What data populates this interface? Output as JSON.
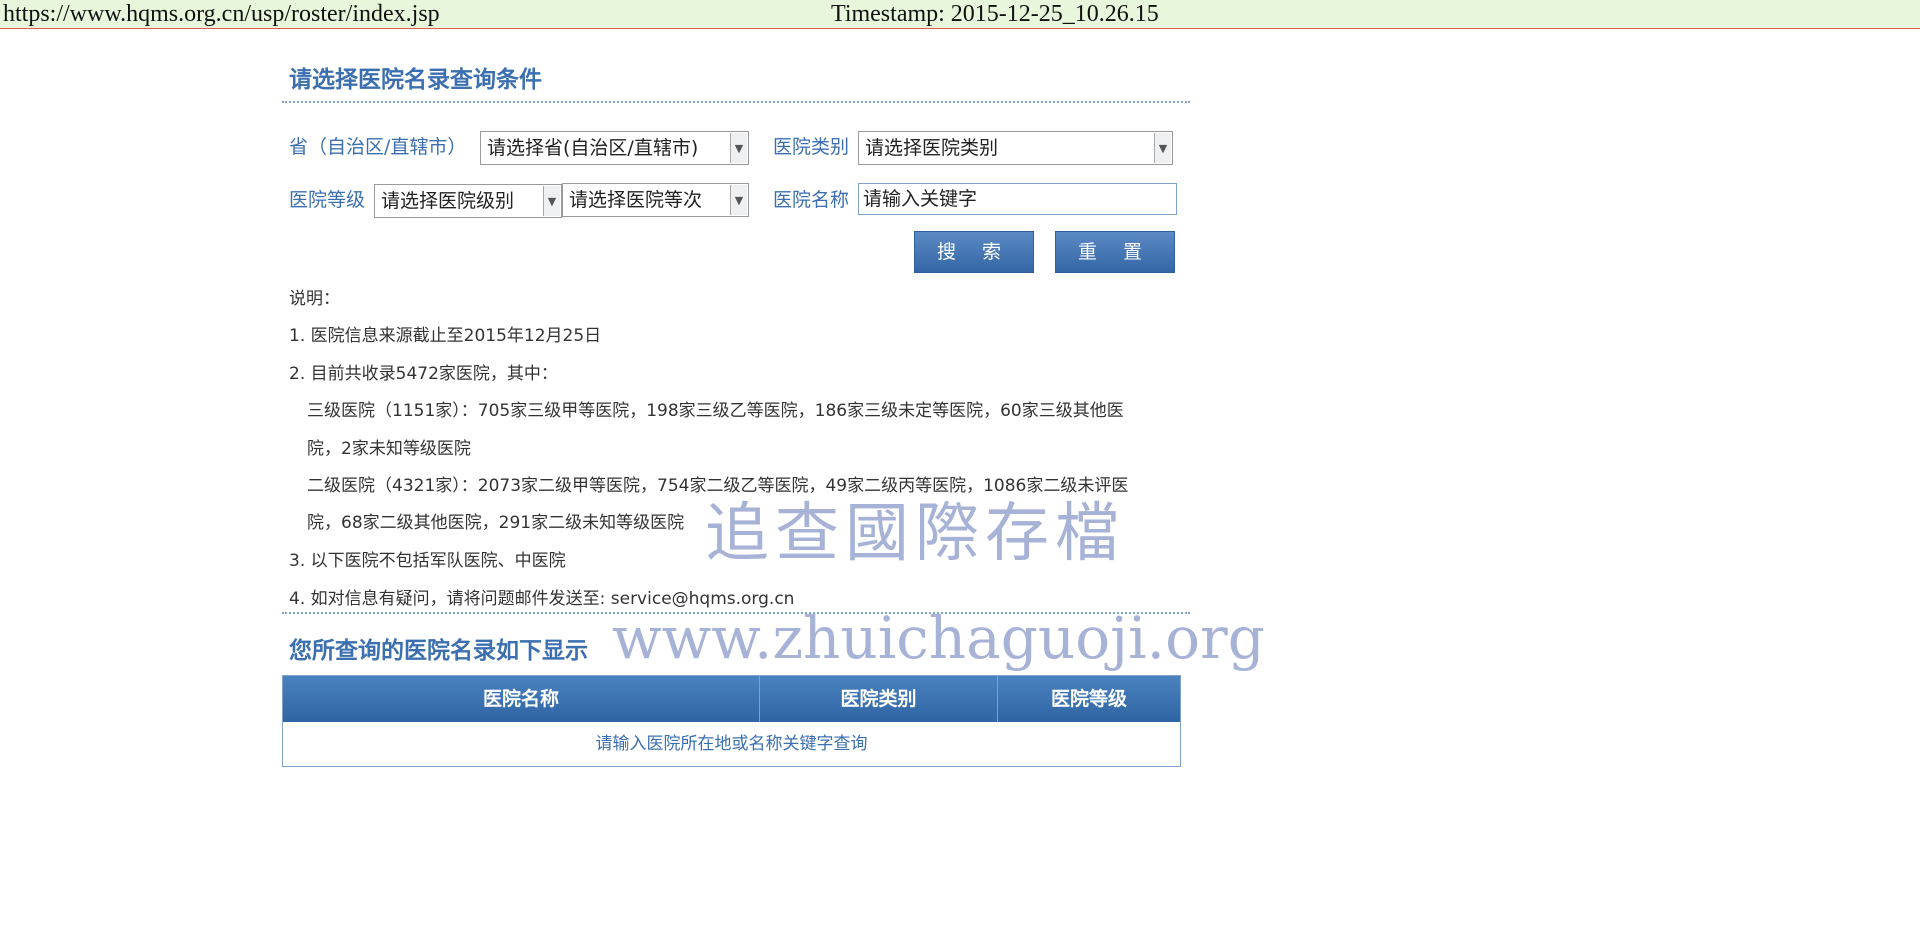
{
  "topbar": {
    "url": "https://www.hqms.org.cn/usp/roster/index.jsp",
    "timestamp": "Timestamp: 2015-12-25_10.26.15"
  },
  "form": {
    "heading": "请选择医院名录查询条件",
    "province_label": "省（自治区/直辖市）",
    "province_select": "请选择省(自治区/直辖市)",
    "category_label": "医院类别",
    "category_select": "请选择医院类别",
    "grade_label": "医院等级",
    "level_select": "请选择医院级别",
    "rank_select": "请选择医院等次",
    "name_label": "医院名称",
    "name_input": "请输入关键字",
    "search_button": "搜 索",
    "reset_button": "重 置"
  },
  "notes": {
    "title": "说明：",
    "lines": [
      "1. 医院信息来源截止至2015年12月25日",
      "2. 目前共收录5472家医院，其中：",
      "三级医院（1151家）：705家三级甲等医院，198家三级乙等医院，186家三级未定等医院，60家三级其他医",
      "院，2家未知等级医院",
      "二级医院（4321家）：2073家二级甲等医院，754家二级乙等医院，49家二级丙等医院，1086家二级未评医",
      "院，68家二级其他医院，291家二级未知等级医院",
      "3. 以下医院不包括军队医院、中医院",
      "4. 如对信息有疑问，请将问题邮件发送至: service@hqms.org.cn"
    ]
  },
  "results": {
    "heading": "您所查询的医院名录如下显示",
    "columns": [
      "医院名称",
      "医院类别",
      "医院等级"
    ],
    "empty_message": "请输入医院所在地或名称关键字查询"
  },
  "watermark": {
    "chinese": "追查國際存檔",
    "url": "www.zhuichaguoji.org"
  },
  "colors": {
    "accent": "#3b6fb0",
    "topbar_bg": "#e8f7dc",
    "table_header": "#3b72b0"
  }
}
